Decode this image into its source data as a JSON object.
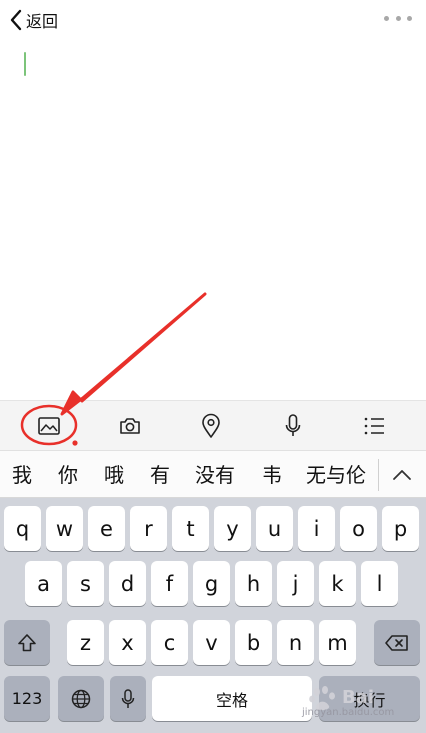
{
  "header": {
    "back_label": "返回",
    "back_icon": "chevron-left-icon",
    "more_icon": "more-dots-icon"
  },
  "toolbar": {
    "items": [
      {
        "icon": "image-icon"
      },
      {
        "icon": "camera-icon"
      },
      {
        "icon": "location-pin-icon"
      },
      {
        "icon": "microphone-icon"
      },
      {
        "icon": "list-icon"
      }
    ]
  },
  "candidates": {
    "items": [
      "我",
      "你",
      "哦",
      "有",
      "没有",
      "韦",
      "无与伦"
    ],
    "expand_icon": "chevron-up-icon"
  },
  "keyboard": {
    "row1": [
      "q",
      "w",
      "e",
      "r",
      "t",
      "y",
      "u",
      "i",
      "o",
      "p"
    ],
    "row2": [
      "a",
      "s",
      "d",
      "f",
      "g",
      "h",
      "j",
      "k",
      "l"
    ],
    "row3": [
      "z",
      "x",
      "c",
      "v",
      "b",
      "n",
      "m"
    ],
    "shift_icon": "shift-icon",
    "delete_icon": "delete-icon",
    "numbers_label": "123",
    "globe_icon": "globe-icon",
    "mic_icon": "microphone-icon",
    "space_label": "空格",
    "return_label": "换行"
  },
  "watermark": {
    "text": "Bai",
    "url": "jingyan.baidu.com"
  },
  "annotation": {
    "color": "#e8302a"
  }
}
